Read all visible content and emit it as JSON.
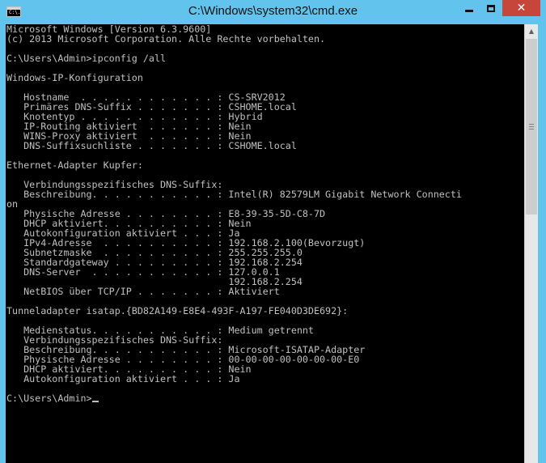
{
  "window": {
    "title": "C:\\Windows\\system32\\cmd.exe",
    "app_icon_text": "C:\\.",
    "controls": {
      "minimize": "minimize",
      "maximize": "maximize",
      "close": "✕"
    }
  },
  "console": {
    "lines": [
      "Microsoft Windows [Version 6.3.9600]",
      "(c) 2013 Microsoft Corporation. Alle Rechte vorbehalten.",
      "",
      "C:\\Users\\Admin>ipconfig /all",
      "",
      "Windows-IP-Konfiguration",
      "",
      "   Hostname  . . . . . . . . . . . . : CS-SRV2012",
      "   Primäres DNS-Suffix . . . . . . . : CSHOME.local",
      "   Knotentyp . . . . . . . . . . . . : Hybrid",
      "   IP-Routing aktiviert  . . . . . . : Nein",
      "   WINS-Proxy aktiviert  . . . . . . : Nein",
      "   DNS-Suffixsuchliste . . . . . . . : CSHOME.local",
      "",
      "Ethernet-Adapter Kupfer:",
      "",
      "   Verbindungsspezifisches DNS-Suffix:",
      "   Beschreibung. . . . . . . . . . . : Intel(R) 82579LM Gigabit Network Connecti",
      "on",
      "   Physische Adresse . . . . . . . . : E8-39-35-5D-C8-7D",
      "   DHCP aktiviert. . . . . . . . . . : Nein",
      "   Autokonfiguration aktiviert . . . : Ja",
      "   IPv4-Adresse  . . . . . . . . . . : 192.168.2.100(Bevorzugt)",
      "   Subnetzmaske  . . . . . . . . . . : 255.255.255.0",
      "   Standardgateway . . . . . . . . . : 192.168.2.254",
      "   DNS-Server  . . . . . . . . . . . : 127.0.0.1",
      "                                       192.168.2.254",
      "   NetBIOS über TCP/IP . . . . . . . : Aktiviert",
      "",
      "Tunneladapter isatap.{BD82A149-E8E4-493F-A197-FE040D3DE692}:",
      "",
      "   Medienstatus. . . . . . . . . . . : Medium getrennt",
      "   Verbindungsspezifisches DNS-Suffix:",
      "   Beschreibung. . . . . . . . . . . : Microsoft-ISATAP-Adapter",
      "   Physische Adresse . . . . . . . . : 00-00-00-00-00-00-00-E0",
      "   DHCP aktiviert. . . . . . . . . . : Nein",
      "   Autokonfiguration aktiviert . . . : Ja",
      ""
    ],
    "prompt": "C:\\Users\\Admin>"
  },
  "scrollbar": {
    "up_arrow": "▲",
    "scroll_position": 0.0
  }
}
